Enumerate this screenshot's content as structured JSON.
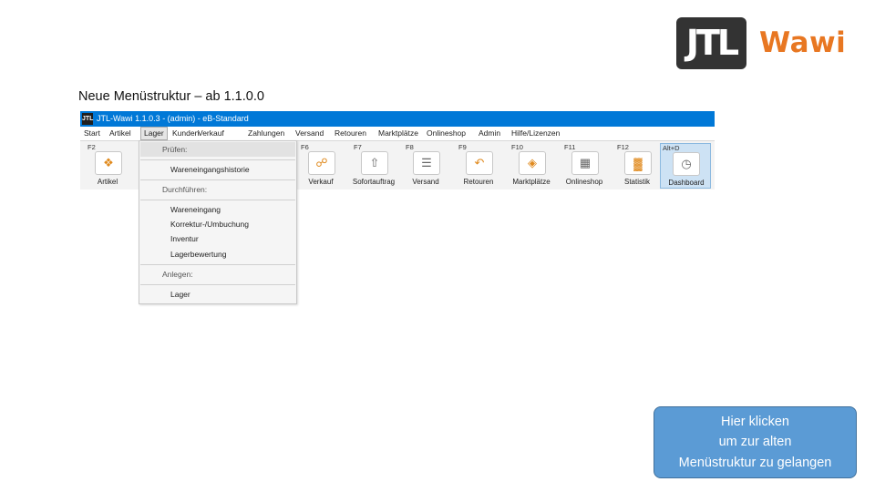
{
  "logo": {
    "mark": "JTL",
    "word": "Wawi"
  },
  "heading": "Neue Menüstruktur – ab 1.1.0.0",
  "app": {
    "title": "JTL-Wawi 1.1.0.3 - (admin) - eB-Standard",
    "menu": [
      "Start",
      "Artikel",
      "Lager",
      "Kunden",
      "Verkauf",
      "Zahlungen",
      "Versand",
      "Retouren",
      "Marktplätze",
      "Onlineshop",
      "Admin",
      "Hilfe/Lizenzen"
    ],
    "ribbon": [
      {
        "key": "F2",
        "label": "Artikel",
        "icon": "tag-icon"
      },
      {
        "key": "F6",
        "label": "Verkauf",
        "icon": "shopping-bag-icon"
      },
      {
        "key": "F7",
        "label": "Sofortauftrag",
        "icon": "box-arrow-icon"
      },
      {
        "key": "F8",
        "label": "Versand",
        "icon": "truck-icon"
      },
      {
        "key": "F9",
        "label": "Retouren",
        "icon": "return-box-icon"
      },
      {
        "key": "F10",
        "label": "Marktplätze",
        "icon": "layers-icon"
      },
      {
        "key": "F11",
        "label": "Onlineshop",
        "icon": "cart-window-icon"
      },
      {
        "key": "F12",
        "label": "Statistik",
        "icon": "bar-chart-icon"
      },
      {
        "key": "Alt+D",
        "label": "Dashboard",
        "icon": "gauge-icon"
      }
    ],
    "dropdown": {
      "sections": [
        {
          "title": "Prüfen:",
          "items": [
            "Wareneingangshistorie"
          ]
        },
        {
          "title": "Durchführen:",
          "items": [
            "Wareneingang",
            "Korrektur-/Umbuchung",
            "Inventur",
            "Lagerbewertung"
          ]
        },
        {
          "title": "Anlegen:",
          "items": [
            "Lager"
          ]
        }
      ]
    }
  },
  "callout": {
    "lines": [
      "Hier klicken",
      "um zur alten",
      "Menüstruktur zu gelangen"
    ]
  },
  "colors": {
    "brand_orange": "#e87722",
    "title_blue": "#0078d7",
    "callout_blue": "#5b9bd5"
  }
}
